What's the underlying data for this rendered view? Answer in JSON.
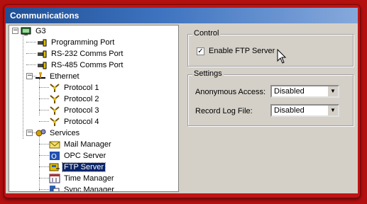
{
  "window": {
    "title": "Communications"
  },
  "tree": {
    "root": "G3",
    "ports": [
      "Programming Port",
      "RS-232 Comms Port",
      "RS-485 Comms Port"
    ],
    "ethernet": {
      "label": "Ethernet",
      "protocols": [
        "Protocol 1",
        "Protocol 2",
        "Protocol 3",
        "Protocol 4"
      ]
    },
    "services": {
      "label": "Services",
      "items": [
        "Mail Manager",
        "OPC Server",
        "FTP Server",
        "Time Manager",
        "Sync Manager"
      ],
      "selected": "FTP Server"
    }
  },
  "control": {
    "legend": "Control",
    "enable_ftp_label": "Enable FTP Server",
    "enable_ftp_checked": true
  },
  "settings": {
    "legend": "Settings",
    "anonymous_access_label": "Anonymous Access:",
    "anonymous_access_value": "Disabled",
    "record_log_label": "Record Log File:",
    "record_log_value": "Disabled"
  },
  "colors": {
    "frame": "#c01414",
    "titlebar": "#2a5aa4",
    "selection": "#0a246a"
  }
}
